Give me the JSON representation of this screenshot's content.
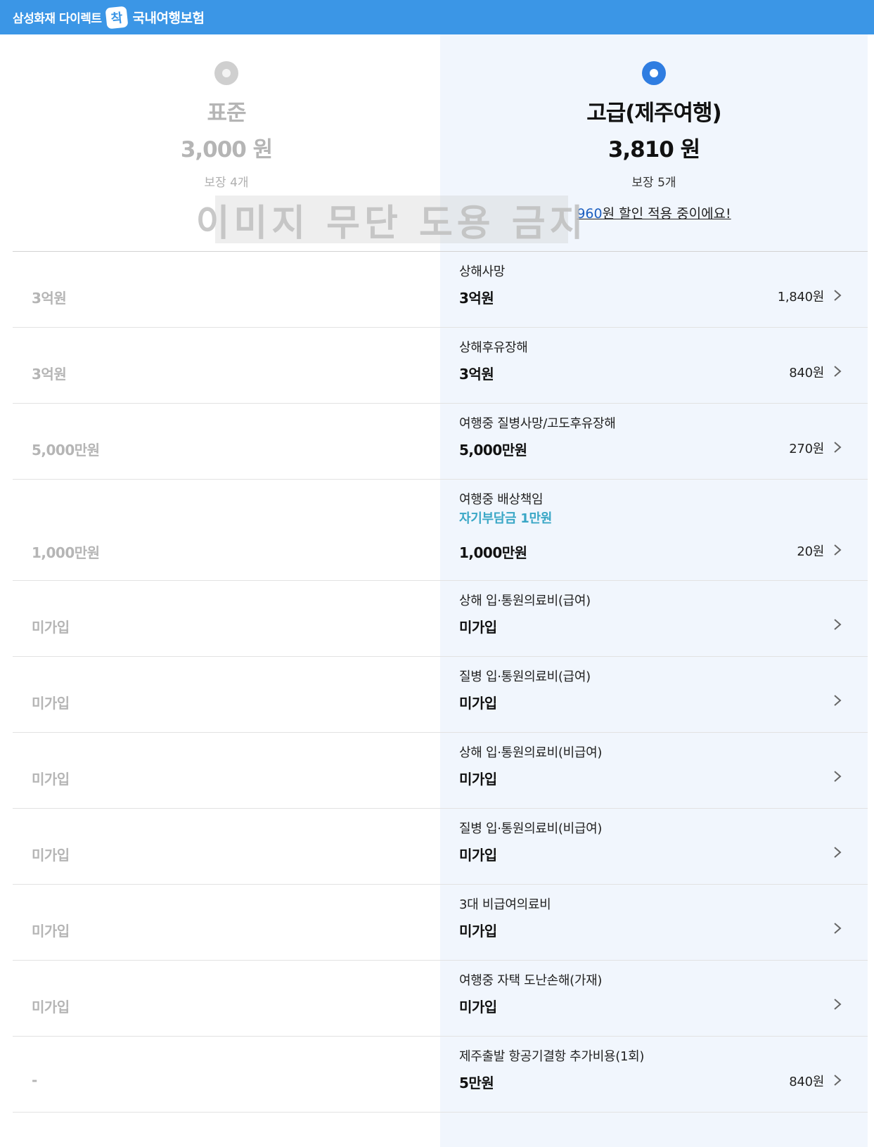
{
  "header": {
    "brand": "삼성화재 다이렉트",
    "logo_text": "착",
    "title": "국내여행보험"
  },
  "watermark": "이미지 무단 도용 금지",
  "plans": {
    "standard": {
      "name": "표준",
      "price": "3,000 원",
      "coverage_count": "보장 4개",
      "selected": false
    },
    "premium": {
      "name": "고급(제주여행)",
      "price": "3,810 원",
      "coverage_count": "보장 5개",
      "selected": true,
      "discount_amount": "960",
      "discount_text": "원 할인 적용 중이에요!"
    }
  },
  "rows": [
    {
      "standard": "3억원",
      "label": "상해사망",
      "sub": "",
      "value": "3억원",
      "price": "1,840원"
    },
    {
      "standard": "3억원",
      "label": "상해후유장해",
      "sub": "",
      "value": "3억원",
      "price": "840원"
    },
    {
      "standard": "5,000만원",
      "label": "여행중 질병사망/고도후유장해",
      "sub": "",
      "value": "5,000만원",
      "price": "270원"
    },
    {
      "standard": "1,000만원",
      "label": "여행중 배상책임",
      "sub": "자기부담금 1만원",
      "value": "1,000만원",
      "price": "20원"
    },
    {
      "standard": "미가입",
      "label": "상해 입·통원의료비(급여)",
      "sub": "",
      "value": "미가입",
      "price": ""
    },
    {
      "standard": "미가입",
      "label": "질병 입·통원의료비(급여)",
      "sub": "",
      "value": "미가입",
      "price": ""
    },
    {
      "standard": "미가입",
      "label": "상해 입·통원의료비(비급여)",
      "sub": "",
      "value": "미가입",
      "price": ""
    },
    {
      "standard": "미가입",
      "label": "질병 입·통원의료비(비급여)",
      "sub": "",
      "value": "미가입",
      "price": ""
    },
    {
      "standard": "미가입",
      "label": "3대 비급여의료비",
      "sub": "",
      "value": "미가입",
      "price": ""
    },
    {
      "standard": "미가입",
      "label": "여행중 자택 도난손해(가재)",
      "sub": "",
      "value": "미가입",
      "price": ""
    },
    {
      "standard": "-",
      "label": "제주출발 항공기결항 추가비용(1회)",
      "sub": "",
      "value": "5만원",
      "price": "840원"
    }
  ]
}
